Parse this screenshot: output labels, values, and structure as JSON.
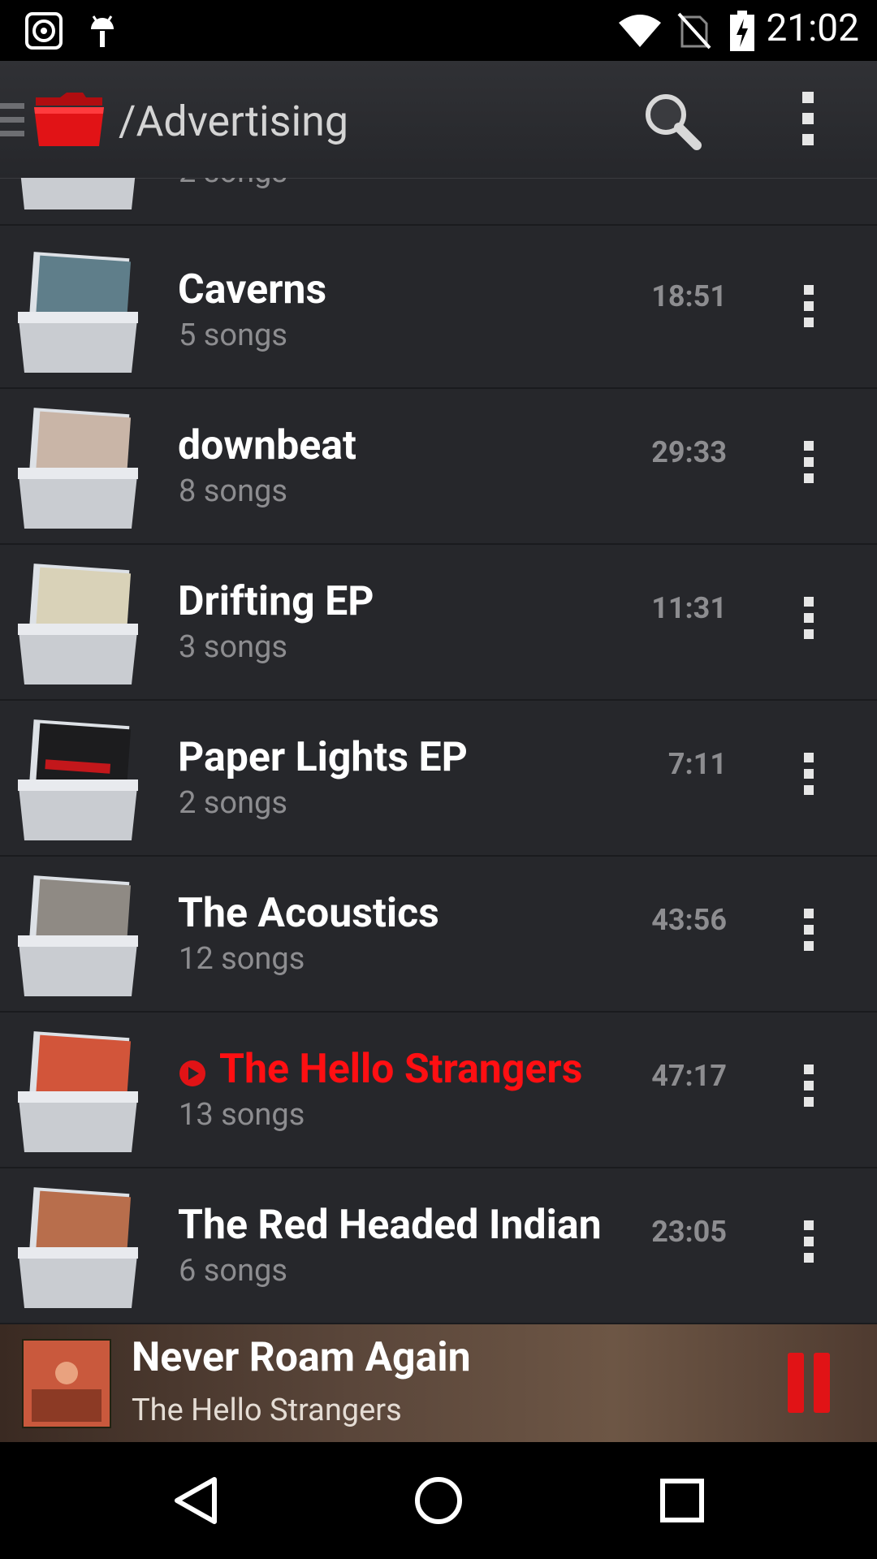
{
  "status_bar": {
    "time": "21:02",
    "left_icons": [
      "music-app-icon",
      "android-debug-icon"
    ],
    "right_icons": [
      "wifi-icon",
      "no-sim-icon",
      "battery-charging-icon"
    ]
  },
  "toolbar": {
    "title": "/Advertising",
    "icons": [
      "drawer-icon",
      "folder-icon",
      "search-icon",
      "overflow-menu-icon"
    ],
    "accent": "#e11316"
  },
  "list": {
    "partial_top_item": {
      "subtitle": "2 songs"
    },
    "items": [
      {
        "name": "Caverns",
        "subtitle": "5 songs",
        "duration": "18:51",
        "playing": false
      },
      {
        "name": "downbeat",
        "subtitle": "8 songs",
        "duration": "29:33",
        "playing": false
      },
      {
        "name": "Drifting EP",
        "subtitle": "3 songs",
        "duration": "11:31",
        "playing": false
      },
      {
        "name": "Paper Lights EP",
        "subtitle": "2 songs",
        "duration": "7:11",
        "playing": false
      },
      {
        "name": "The Acoustics",
        "subtitle": "12 songs",
        "duration": "43:56",
        "playing": false
      },
      {
        "name": "The Hello Strangers",
        "subtitle": "13 songs",
        "duration": "47:17",
        "playing": true
      },
      {
        "name": "The Red Headed Indian",
        "subtitle": "6 songs",
        "duration": "23:05",
        "playing": false
      }
    ],
    "playing_color": "#ff0f12"
  },
  "now_playing": {
    "song": "Never Roam Again",
    "artist": "The Hello Strangers",
    "pause_icon": "pause-icon"
  },
  "nav_bar": {
    "icons": [
      "back-icon",
      "home-icon",
      "recents-icon"
    ]
  }
}
